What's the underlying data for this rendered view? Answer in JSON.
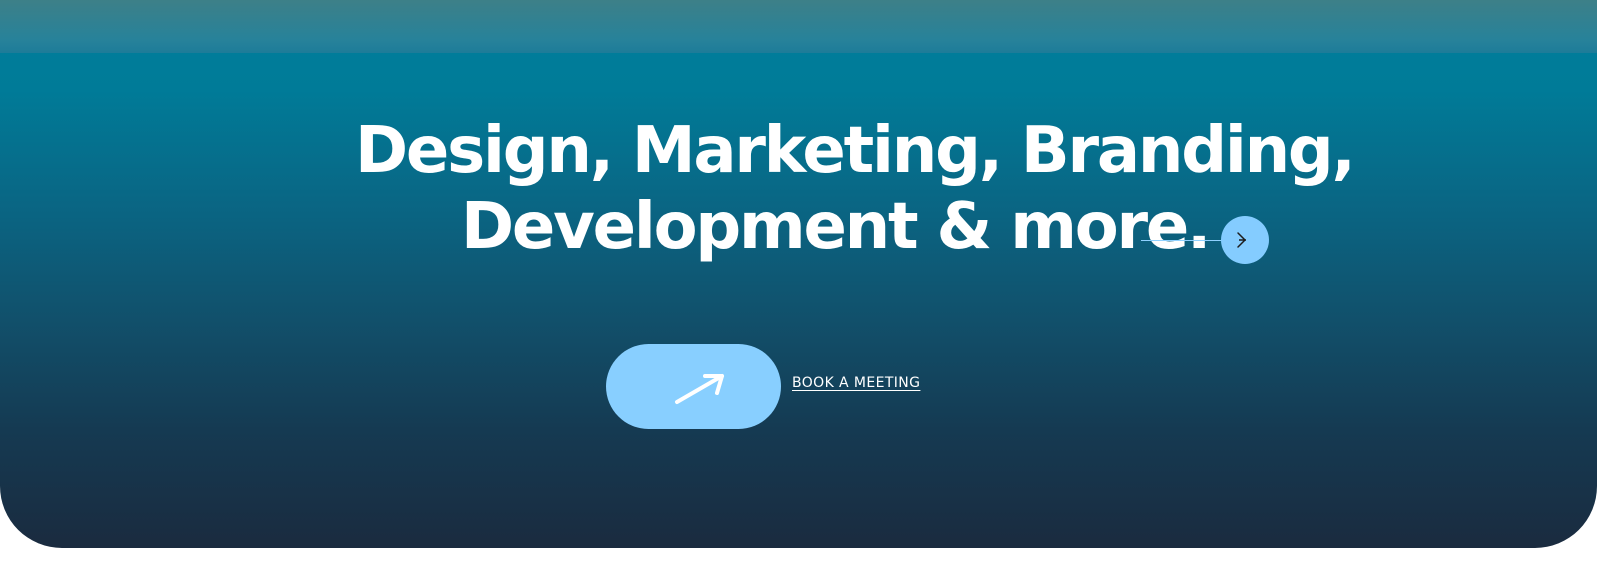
{
  "hero": {
    "headline_line1": "Design, Marketing, Branding,",
    "headline_line2": "Development & more.",
    "arrow_icon": "arrow-right-icon",
    "cta_icon": "arrow-up-right-icon",
    "book_meeting_label": "BOOK A MEETING"
  },
  "colors": {
    "gradient_top": "#007f9c",
    "gradient_bottom": "#1a2b3f",
    "accent": "#84ccff",
    "text": "#ffffff"
  }
}
